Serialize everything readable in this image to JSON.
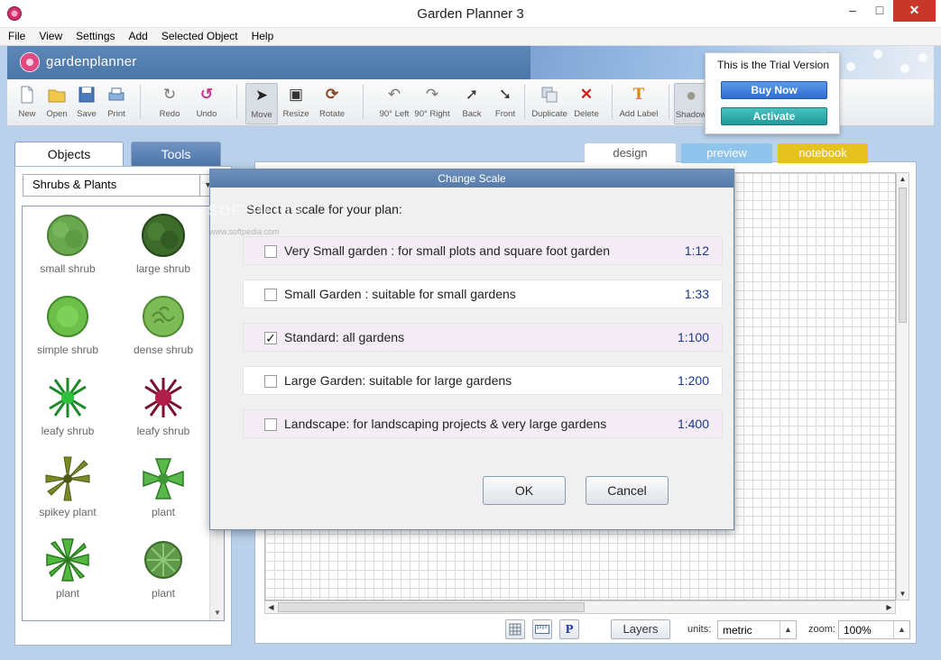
{
  "window": {
    "title": "Garden Planner 3",
    "min": "–",
    "max": "□",
    "close": "✕"
  },
  "menu": [
    "File",
    "View",
    "Settings",
    "Add",
    "Selected Object",
    "Help"
  ],
  "brand": {
    "name": "gardenplanner"
  },
  "toolbar": {
    "new": "New",
    "open": "Open",
    "save": "Save",
    "print": "Print",
    "redo": "Redo",
    "undo": "Undo",
    "move": "Move",
    "resize": "Resize",
    "rotate": "Rotate",
    "rot_left": "90° Left",
    "rot_right": "90° Right",
    "back": "Back",
    "front": "Front",
    "duplicate": "Duplicate",
    "delete": "Delete",
    "add_label": "Add Label",
    "shadow": "Shadow"
  },
  "trial": {
    "text": "This is the Trial Version",
    "buy": "Buy Now",
    "activate": "Activate"
  },
  "left_panel": {
    "tabs": {
      "objects": "Objects",
      "tools": "Tools"
    },
    "category": "Shrubs & Plants",
    "plants": [
      {
        "name": "small shrub",
        "color": "#6aa84f"
      },
      {
        "name": "large shrub",
        "color": "#3d6b2a"
      },
      {
        "name": "simple shrub",
        "color": "#6cc04a"
      },
      {
        "name": "dense shrub",
        "color": "#7cbb55"
      },
      {
        "name": "leafy shrub",
        "color": "#2fbf3a"
      },
      {
        "name": "leafy shrub",
        "color": "#b01e4a"
      },
      {
        "name": "spikey plant",
        "color": "#7a8a2a"
      },
      {
        "name": "plant",
        "color": "#58b84a"
      },
      {
        "name": "plant",
        "color": "#52b840"
      },
      {
        "name": "plant",
        "color": "#5f9a4a"
      }
    ]
  },
  "view_tabs": {
    "design": "design",
    "preview": "preview",
    "notebook": "notebook"
  },
  "bottom": {
    "p_label": "P",
    "layers": "Layers",
    "units_label": "units:",
    "units": "metric",
    "zoom_label": "zoom:",
    "zoom": "100%"
  },
  "dialog": {
    "title": "Change Scale",
    "prompt": "Select a scale for your plan:",
    "options": [
      {
        "label": "Very Small garden : for small plots and square foot garden",
        "ratio": "1:12",
        "checked": false
      },
      {
        "label": "Small Garden : suitable for small gardens",
        "ratio": "1:33",
        "checked": false
      },
      {
        "label": "Standard: all gardens",
        "ratio": "1:100",
        "checked": true
      },
      {
        "label": "Large Garden: suitable for large gardens",
        "ratio": "1:200",
        "checked": false
      },
      {
        "label": "Landscape: for landscaping projects & very large gardens",
        "ratio": "1:400",
        "checked": false
      }
    ],
    "ok": "OK",
    "cancel": "Cancel"
  },
  "watermark": {
    "text": "SOFTPEDIA",
    "url": "www.softpedia.com"
  }
}
